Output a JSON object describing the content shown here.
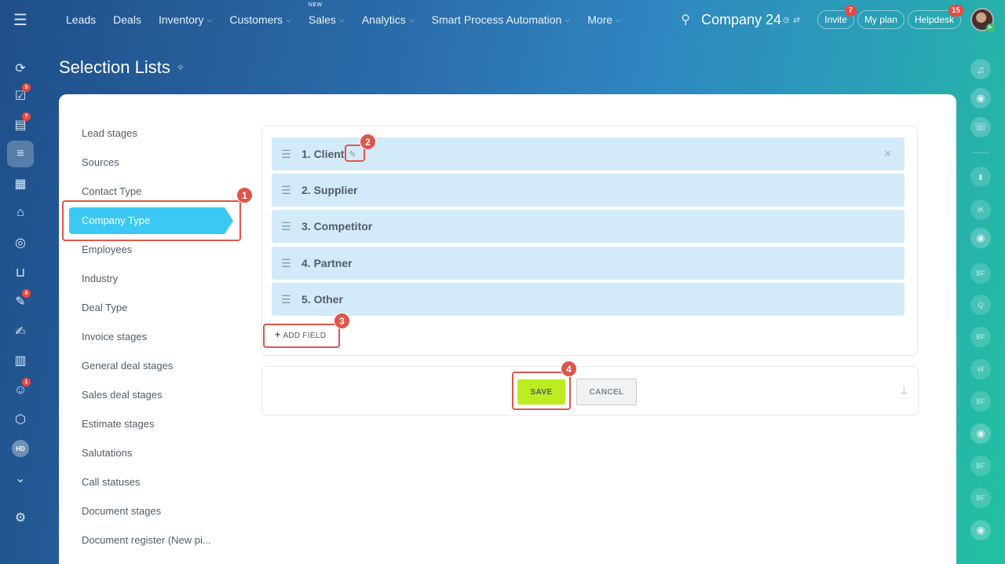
{
  "topbar": {
    "nav": [
      {
        "label": "Leads",
        "chevron": false
      },
      {
        "label": "Deals",
        "chevron": false
      },
      {
        "label": "Inventory",
        "chevron": true
      },
      {
        "label": "Customers",
        "chevron": true
      },
      {
        "label": "Sales",
        "chevron": true,
        "tag": "NEW"
      },
      {
        "label": "Analytics",
        "chevron": true
      },
      {
        "label": "Smart Process Automation",
        "chevron": true
      },
      {
        "label": "More",
        "chevron": true
      }
    ],
    "company_name": "Company 24",
    "invite_label": "Invite",
    "invite_badge": "7",
    "myplan_label": "My plan",
    "helpdesk_label": "Helpdesk",
    "helpdesk_badge": "15"
  },
  "leftbar": {
    "badges": {
      "tasks": "5",
      "feed": "7",
      "docs": "6",
      "robot": "1"
    },
    "hd_label": "HD"
  },
  "rightbar": {
    "avatars": [
      "IK",
      "BF",
      "Q",
      "BF",
      "W",
      "BF",
      "BF",
      "BF"
    ]
  },
  "page": {
    "title": "Selection Lists"
  },
  "menu": {
    "items": [
      "Lead stages",
      "Sources",
      "Contact Type",
      "Company Type",
      "Employees",
      "Industry",
      "Deal Type",
      "Invoice stages",
      "General deal stages",
      "Sales deal stages",
      "Estimate stages",
      "Salutations",
      "Call statuses",
      "Document stages",
      "Document register (New pi..."
    ],
    "active": "Company Type"
  },
  "fields": {
    "items": [
      "1. Client",
      "2. Supplier",
      "3. Competitor",
      "4. Partner",
      "5. Other"
    ],
    "add_label": "ADD FIELD"
  },
  "actions": {
    "save_label": "SAVE",
    "cancel_label": "CANCEL"
  },
  "annotations": [
    "1",
    "2",
    "3",
    "4"
  ],
  "colors": {
    "accent": "#3bc8f5",
    "save": "#bbed21",
    "field_bg": "#d3ebf8",
    "annotation": "#e0554b"
  }
}
